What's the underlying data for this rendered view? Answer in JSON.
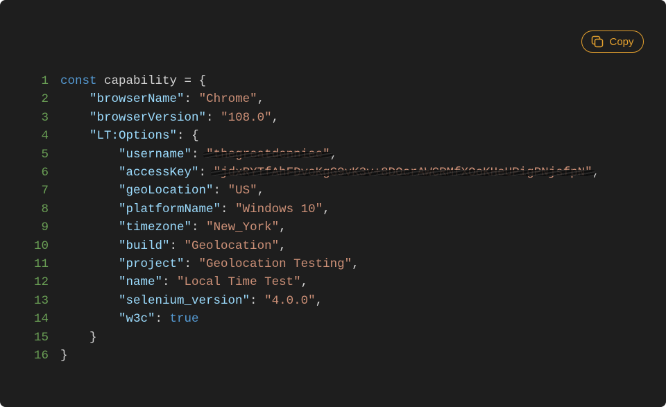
{
  "copy_button": {
    "label": "Copy",
    "icon": "copy-icon",
    "color": "#e5a12e"
  },
  "colors": {
    "background": "#1e1e1e",
    "keyword": "#569cd6",
    "key": "#9cdcfe",
    "string": "#ce9178",
    "line_number": "#6a9f55"
  },
  "code": {
    "lines": [
      {
        "n": "1",
        "indent": "",
        "kw": "const",
        "text": " capability = {"
      },
      {
        "n": "2",
        "indent": "    ",
        "key": "\"browserName\"",
        "sep": ": ",
        "str": "\"Chrome\"",
        "end": ","
      },
      {
        "n": "3",
        "indent": "    ",
        "key": "\"browserVersion\"",
        "sep": ": ",
        "str": "\"108.0\"",
        "end": ","
      },
      {
        "n": "4",
        "indent": "    ",
        "key": "\"LT:Options\"",
        "sep": ": ",
        "end": "{"
      },
      {
        "n": "5",
        "indent": "        ",
        "key": "\"username\"",
        "sep": ": ",
        "str": "\"thegreatdenniee\"",
        "end": ",",
        "redacted": true
      },
      {
        "n": "6",
        "indent": "        ",
        "key": "\"accessKey\"",
        "sep": ": ",
        "str": "\"jdxRYTfAhFDvoKgG9vK3v+8DOcrAWCRMfXOoKHeUPigPNjsfpN\"",
        "end": ",",
        "redacted": true
      },
      {
        "n": "7",
        "indent": "        ",
        "key": "\"geoLocation\"",
        "sep": ": ",
        "str": "\"US\"",
        "end": ","
      },
      {
        "n": "8",
        "indent": "        ",
        "key": "\"platformName\"",
        "sep": ": ",
        "str": "\"Windows 10\"",
        "end": ","
      },
      {
        "n": "9",
        "indent": "        ",
        "key": "\"timezone\"",
        "sep": ": ",
        "str": "\"New_York\"",
        "end": ","
      },
      {
        "n": "10",
        "indent": "        ",
        "key": "\"build\"",
        "sep": ": ",
        "str": "\"Geolocation\"",
        "end": ","
      },
      {
        "n": "11",
        "indent": "        ",
        "key": "\"project\"",
        "sep": ": ",
        "str": "\"Geolocation Testing\"",
        "end": ","
      },
      {
        "n": "12",
        "indent": "        ",
        "key": "\"name\"",
        "sep": ": ",
        "str": "\"Local Time Test\"",
        "end": ","
      },
      {
        "n": "13",
        "indent": "        ",
        "key": "\"selenium_version\"",
        "sep": ": ",
        "str": "\"4.0.0\"",
        "end": ","
      },
      {
        "n": "14",
        "indent": "        ",
        "key": "\"w3c\"",
        "sep": ": ",
        "kw2": "true"
      },
      {
        "n": "15",
        "indent": "    ",
        "end": "}"
      },
      {
        "n": "16",
        "indent": "",
        "end": "}"
      }
    ]
  }
}
